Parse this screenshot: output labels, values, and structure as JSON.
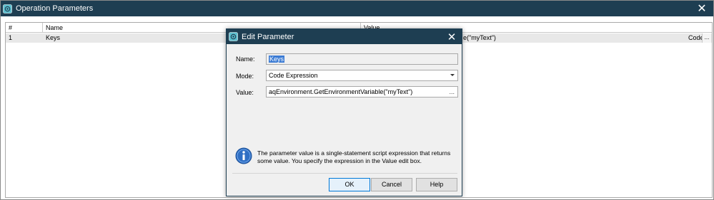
{
  "outer": {
    "title": "Operation Parameters",
    "columns": {
      "num": "#",
      "name": "Name",
      "value": "Value"
    },
    "rows": [
      {
        "num": "1",
        "name": "Keys",
        "value_visible": "e(\"myText\")",
        "mode": "Code",
        "more": "..."
      }
    ]
  },
  "dialog": {
    "title": "Edit Parameter",
    "name_label": "Name:",
    "name_value": "Keys",
    "mode_label": "Mode:",
    "mode_value": "Code Expression",
    "value_label": "Value:",
    "value_value": "aqEnvironment.GetEnvironmentVariable(\"myText\")",
    "value_more": "...",
    "info_text": "The parameter value is a single-statement script expression that returns some value. You specify the expression in the Value edit box.",
    "ok_label": "OK",
    "cancel_label": "Cancel",
    "help_label": "Help"
  },
  "colors": {
    "titlebar": "#1e3e52",
    "row_highlight": "#e8e8e8",
    "selection": "#3b7bd4",
    "info_blue": "#2f6fc4"
  }
}
